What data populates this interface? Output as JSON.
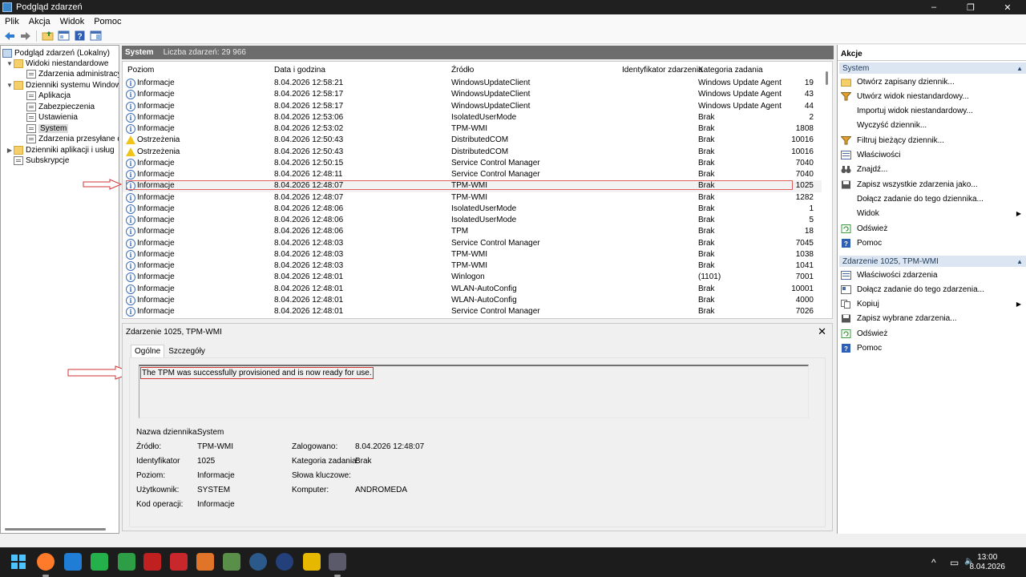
{
  "window": {
    "title": "Podgląd zdarzeń",
    "minimize": "–",
    "maximize": "❐",
    "close": "✕"
  },
  "menu": [
    "Plik",
    "Akcja",
    "Widok",
    "Pomoc"
  ],
  "toolbar": {
    "icons": [
      "back-arrow-icon",
      "forward-arrow-icon",
      "folder-up-icon",
      "panel-icon",
      "help-icon",
      "panel-view-icon"
    ]
  },
  "tree": {
    "root": "Podgląd zdarzeń (Lokalny)",
    "custom_views": "Widoki niestandardowe",
    "admin_events": "Zdarzenia administracyjne",
    "windows_logs": "Dzienniki systemu Windows",
    "app": "Aplikacja",
    "security": "Zabezpieczenia",
    "setup": "Ustawienia",
    "system": "System",
    "forwarded": "Zdarzenia przesyłane dale",
    "app_services": "Dzienniki aplikacji i usług",
    "subscriptions": "Subskrypcje"
  },
  "center": {
    "log_name": "System",
    "count_label": "Liczba zdarzeń: 29 966"
  },
  "columns": {
    "level": "Poziom",
    "date": "Data i godzina",
    "source": "Źródło",
    "id": "Identyfikator zdarzenia",
    "category": "Kategoria zadania"
  },
  "events": [
    {
      "level": "Informacje",
      "type": "info",
      "date": "8.04.2026 12:58:21",
      "source": "WindowsUpdateClient",
      "id": "19",
      "category": "Windows Update Agent"
    },
    {
      "level": "Informacje",
      "type": "info",
      "date": "8.04.2026 12:58:17",
      "source": "WindowsUpdateClient",
      "id": "43",
      "category": "Windows Update Agent"
    },
    {
      "level": "Informacje",
      "type": "info",
      "date": "8.04.2026 12:58:17",
      "source": "WindowsUpdateClient",
      "id": "44",
      "category": "Windows Update Agent"
    },
    {
      "level": "Informacje",
      "type": "info",
      "date": "8.04.2026 12:53:06",
      "source": "IsolatedUserMode",
      "id": "2",
      "category": "Brak"
    },
    {
      "level": "Informacje",
      "type": "info",
      "date": "8.04.2026 12:53:02",
      "source": "TPM-WMI",
      "id": "1808",
      "category": "Brak"
    },
    {
      "level": "Ostrzeżenia",
      "type": "warn",
      "date": "8.04.2026 12:50:43",
      "source": "DistributedCOM",
      "id": "10016",
      "category": "Brak"
    },
    {
      "level": "Ostrzeżenia",
      "type": "warn",
      "date": "8.04.2026 12:50:43",
      "source": "DistributedCOM",
      "id": "10016",
      "category": "Brak"
    },
    {
      "level": "Informacje",
      "type": "info",
      "date": "8.04.2026 12:50:15",
      "source": "Service Control Manager",
      "id": "7040",
      "category": "Brak"
    },
    {
      "level": "Informacje",
      "type": "info",
      "date": "8.04.2026 12:48:11",
      "source": "Service Control Manager",
      "id": "7040",
      "category": "Brak"
    },
    {
      "level": "Informacje",
      "type": "info",
      "date": "8.04.2026 12:48:07",
      "source": "TPM-WMI",
      "id": "1025",
      "category": "Brak"
    },
    {
      "level": "Informacje",
      "type": "info",
      "date": "8.04.2026 12:48:07",
      "source": "TPM-WMI",
      "id": "1282",
      "category": "Brak"
    },
    {
      "level": "Informacje",
      "type": "info",
      "date": "8.04.2026 12:48:06",
      "source": "IsolatedUserMode",
      "id": "1",
      "category": "Brak"
    },
    {
      "level": "Informacje",
      "type": "info",
      "date": "8.04.2026 12:48:06",
      "source": "IsolatedUserMode",
      "id": "5",
      "category": "Brak"
    },
    {
      "level": "Informacje",
      "type": "info",
      "date": "8.04.2026 12:48:06",
      "source": "TPM",
      "id": "18",
      "category": "Brak"
    },
    {
      "level": "Informacje",
      "type": "info",
      "date": "8.04.2026 12:48:03",
      "source": "Service Control Manager",
      "id": "7045",
      "category": "Brak"
    },
    {
      "level": "Informacje",
      "type": "info",
      "date": "8.04.2026 12:48:03",
      "source": "TPM-WMI",
      "id": "1038",
      "category": "Brak"
    },
    {
      "level": "Informacje",
      "type": "info",
      "date": "8.04.2026 12:48:03",
      "source": "TPM-WMI",
      "id": "1041",
      "category": "Brak"
    },
    {
      "level": "Informacje",
      "type": "info",
      "date": "8.04.2026 12:48:01",
      "source": "Winlogon",
      "id": "7001",
      "category": "(1101)"
    },
    {
      "level": "Informacje",
      "type": "info",
      "date": "8.04.2026 12:48:01",
      "source": "WLAN-AutoConfig",
      "id": "10001",
      "category": "Brak"
    },
    {
      "level": "Informacje",
      "type": "info",
      "date": "8.04.2026 12:48:01",
      "source": "WLAN-AutoConfig",
      "id": "4000",
      "category": "Brak"
    },
    {
      "level": "Informacje",
      "type": "info",
      "date": "8.04.2026 12:48:01",
      "source": "Service Control Manager",
      "id": "7026",
      "category": "Brak"
    }
  ],
  "detail": {
    "title": "Zdarzenie 1025, TPM-WMI",
    "close": "✕",
    "tab_general": "Ogólne",
    "tab_details": "Szczegóły",
    "description": "The TPM was successfully provisioned and is now ready for use.",
    "log_name_label": "Nazwa dziennika:",
    "log_name": "System",
    "source_label": "Źródło:",
    "source": "TPM-WMI",
    "logged_label": "Zalogowano:",
    "logged": "8.04.2026 12:48:07",
    "id_label": "Identyfikator",
    "id": "1025",
    "category_label": "Kategoria zadania:",
    "category": "Brak",
    "level_label": "Poziom:",
    "level": "Informacje",
    "keywords_label": "Słowa kluczowe:",
    "user_label": "Użytkownik:",
    "user": "SYSTEM",
    "computer_label": "Komputer:",
    "computer": "ANDROMEDA",
    "opcode_label": "Kod operacji:",
    "opcode": "Informacje"
  },
  "actions": {
    "title": "Akcje",
    "system_section": "System",
    "system_items": [
      {
        "label": "Otwórz zapisany dziennik...",
        "icon": "folder-open-icon"
      },
      {
        "label": "Utwórz widok niestandardowy...",
        "icon": "filter-icon"
      },
      {
        "label": "Importuj widok niestandardowy...",
        "icon": ""
      },
      {
        "label": "Wyczyść dziennik...",
        "icon": ""
      },
      {
        "label": "Filtruj bieżący dziennik...",
        "icon": "filter-icon"
      },
      {
        "label": "Właściwości",
        "icon": "properties-icon"
      },
      {
        "label": "Znajdź...",
        "icon": "binoculars-icon"
      },
      {
        "label": "Zapisz wszystkie zdarzenia jako...",
        "icon": "save-icon"
      },
      {
        "label": "Dołącz zadanie do tego dziennika...",
        "icon": ""
      },
      {
        "label": "Widok",
        "icon": "",
        "submenu": "▶"
      },
      {
        "label": "Odśwież",
        "icon": "refresh-icon"
      },
      {
        "label": "Pomoc",
        "icon": "help-icon"
      }
    ],
    "event_section": "Zdarzenie 1025, TPM-WMI",
    "event_items": [
      {
        "label": "Właściwości zdarzenia",
        "icon": "properties-icon"
      },
      {
        "label": "Dołącz zadanie do tego zdarzenia...",
        "icon": "task-icon"
      },
      {
        "label": "Kopiuj",
        "icon": "copy-icon",
        "submenu": "▶"
      },
      {
        "label": "Zapisz wybrane zdarzenia...",
        "icon": "save-icon"
      },
      {
        "label": "Odśwież",
        "icon": "refresh-icon"
      },
      {
        "label": "Pomoc",
        "icon": "help-icon"
      }
    ],
    "collapse": "▲"
  },
  "taskbar": {
    "apps": [
      "windows-start-icon",
      "firefox-icon",
      "app-icon",
      "app-icon",
      "app-icon",
      "app-icon",
      "app-icon",
      "cpu-icon",
      "app-icon",
      "gear-icon",
      "steam-icon",
      "app-icon",
      "event-viewer-icon"
    ],
    "tray": {
      "chevron": "^",
      "network": "▭",
      "volume": "🔈"
    },
    "time": "13:00",
    "date": "8.04.2026"
  },
  "colors": {
    "accent": "#3f6eb5",
    "highlight_border": "#d23434",
    "section_bg": "#dce6f2"
  }
}
